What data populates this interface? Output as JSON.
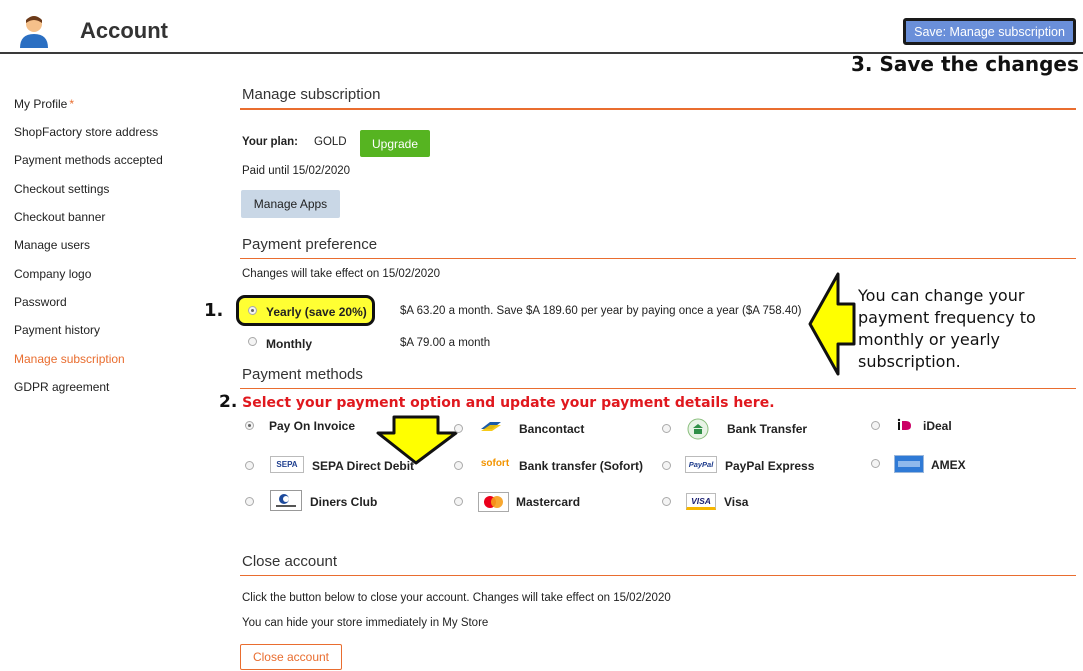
{
  "header": {
    "title": "Account",
    "avatar_icon": "user-avatar-icon",
    "save_label": "Save: Manage subscription"
  },
  "annotations": {
    "save": "3. Save the changes",
    "step1": "1.",
    "step2_num": "2.",
    "step2_text": "Select your payment option and update your payment details here.",
    "side_note": "You can change your payment frequency to monthly or yearly subscription."
  },
  "sidebar": {
    "items": [
      {
        "label": "My Profile",
        "required": "*"
      },
      {
        "label": "ShopFactory store address"
      },
      {
        "label": "Payment methods accepted"
      },
      {
        "label": "Checkout settings"
      },
      {
        "label": "Checkout banner"
      },
      {
        "label": "Manage users"
      },
      {
        "label": "Company logo"
      },
      {
        "label": "Password"
      },
      {
        "label": "Payment history"
      },
      {
        "label": "Manage subscription",
        "active": true
      },
      {
        "label": "GDPR agreement"
      }
    ]
  },
  "manage": {
    "title": "Manage subscription",
    "plan_label": "Your plan:",
    "plan_value": "GOLD",
    "upgrade_label": "Upgrade",
    "paid_until": "Paid until 15/02/2020",
    "manage_apps_label": "Manage Apps"
  },
  "preference": {
    "title": "Payment preference",
    "note": "Changes will take effect on 15/02/2020",
    "options": [
      {
        "label": "Yearly (save 20%)",
        "desc": "$A 63.20 a month. Save $A 189.60 per year by paying once a year ($A 758.40)",
        "checked": true
      },
      {
        "label": "Monthly",
        "desc": "$A 79.00 a month",
        "checked": false
      }
    ]
  },
  "methods": {
    "title": "Payment methods",
    "items": [
      {
        "label": "Pay On Invoice",
        "checked": true
      },
      {
        "label": "Bancontact",
        "icon": "bancontact-icon"
      },
      {
        "label": "Bank Transfer",
        "icon": "bank-transfer-icon"
      },
      {
        "label": "iDeal",
        "icon": "ideal-icon"
      },
      {
        "label": "SEPA Direct Debit",
        "icon": "sepa-icon",
        "icon_text": "SEPA"
      },
      {
        "label": "Bank transfer (Sofort)",
        "icon": "sofort-icon",
        "icon_text": "sofort"
      },
      {
        "label": "PayPal Express",
        "icon": "paypal-icon",
        "icon_text": "PayPal"
      },
      {
        "label": "AMEX",
        "icon": "amex-icon"
      },
      {
        "label": "Diners Club",
        "icon": "diners-club-icon"
      },
      {
        "label": "Mastercard",
        "icon": "mastercard-icon"
      },
      {
        "label": "Visa",
        "icon": "visa-icon",
        "icon_text": "VISA"
      }
    ]
  },
  "close": {
    "title": "Close account",
    "line1": "Click the button below to close your account. Changes will take effect on 15/02/2020",
    "line2": "You can hide your store immediately in My Store",
    "button_label": "Close account"
  },
  "colors": {
    "accent": "#e96d2f",
    "save_button": "#6a8fd9",
    "upgrade": "#56b421",
    "highlight": "#ffff33",
    "annotation_red": "#e0181e"
  }
}
